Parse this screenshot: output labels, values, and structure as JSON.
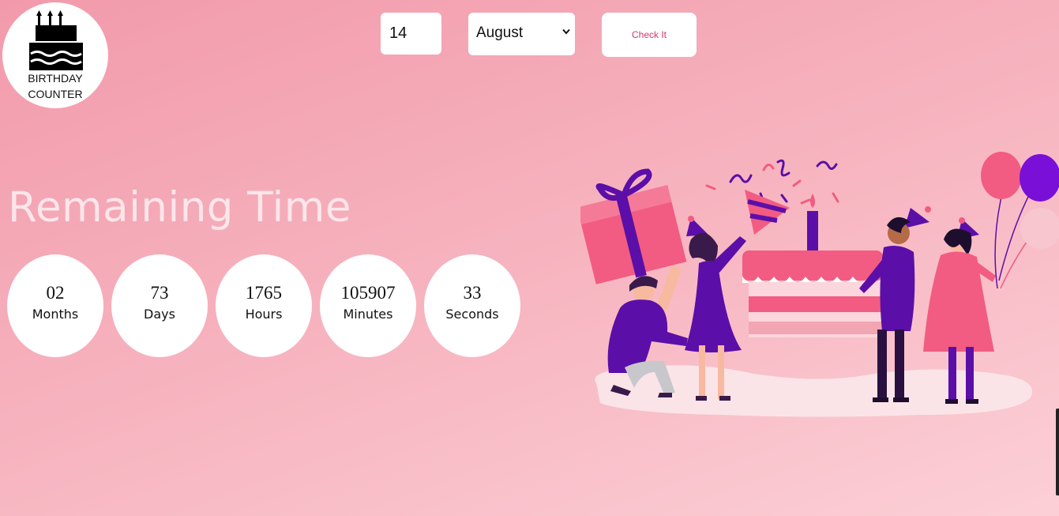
{
  "logo": {
    "line1": "Birthday",
    "line2": "Counter",
    "icon": "birthday-cake-icon"
  },
  "controls": {
    "day_value": "14",
    "month_value": "August",
    "check_label": "Check It"
  },
  "remaining": {
    "title": "Remaining Time"
  },
  "counters": [
    {
      "value": "02",
      "label": "Months"
    },
    {
      "value": "73",
      "label": "Days"
    },
    {
      "value": "1765",
      "label": "Hours"
    },
    {
      "value": "105907",
      "label": "Minutes"
    },
    {
      "value": "33",
      "label": "Seconds"
    }
  ],
  "colors": {
    "accent": "#d0386a",
    "gift": "#f25c82",
    "purple": "#5b0fa8",
    "background_top": "#f29aab",
    "background_bottom": "#fccfd6"
  }
}
